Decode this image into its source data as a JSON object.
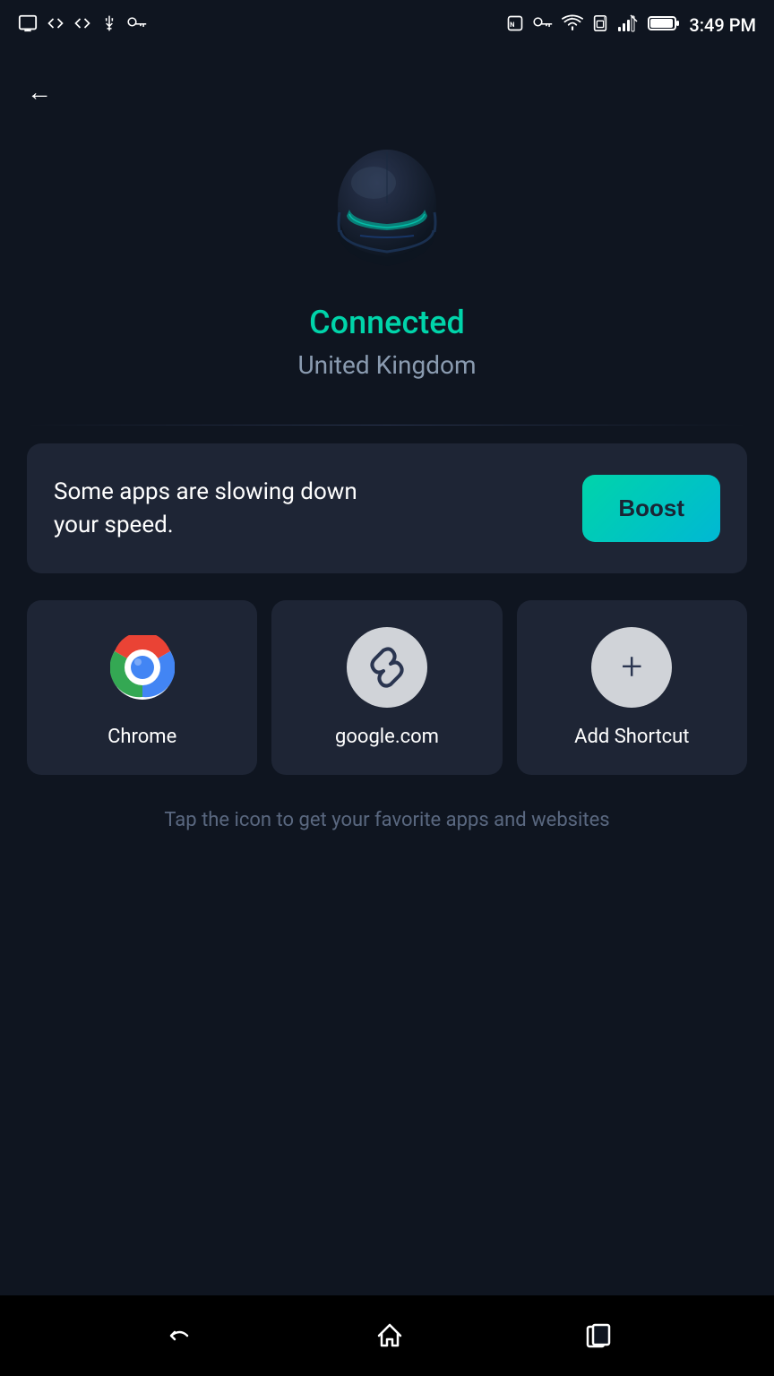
{
  "statusBar": {
    "time": "3:49 PM",
    "icons": [
      "screenshot",
      "code1",
      "code2",
      "usb",
      "key",
      "nfc",
      "vpnkey",
      "wifi",
      "sim",
      "signal",
      "battery"
    ]
  },
  "backButton": {
    "label": "Back"
  },
  "hero": {
    "statusLabel": "Connected",
    "countryLabel": "United Kingdom"
  },
  "boostCard": {
    "message": "Some apps are slowing down your speed.",
    "buttonLabel": "Boost"
  },
  "shortcuts": [
    {
      "id": "chrome",
      "label": "Chrome",
      "iconType": "chrome"
    },
    {
      "id": "google",
      "label": "google.com",
      "iconType": "link"
    },
    {
      "id": "add",
      "label": "Add Shortcut",
      "iconType": "add"
    }
  ],
  "hintText": "Tap the icon to get your favorite apps and websites",
  "navBar": {
    "backIcon": "↩",
    "homeIcon": "⌂",
    "recentsIcon": "▣"
  }
}
